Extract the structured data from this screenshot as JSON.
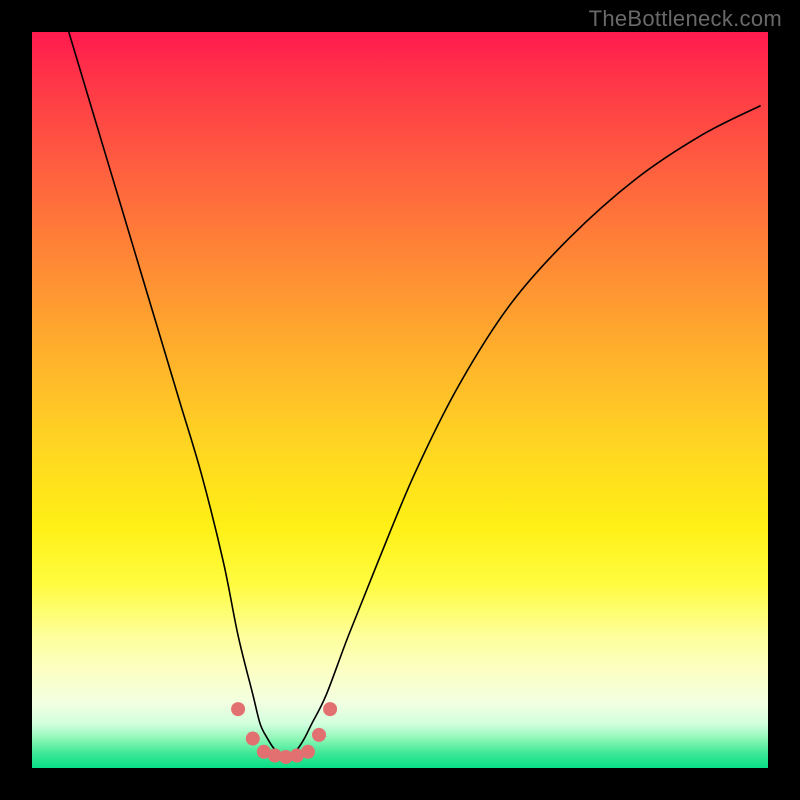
{
  "watermark": "TheBottleneck.com",
  "chart_data": {
    "type": "line",
    "title": "",
    "xlabel": "",
    "ylabel": "",
    "xlim": [
      0,
      100
    ],
    "ylim": [
      0,
      100
    ],
    "grid": false,
    "series": [
      {
        "name": "curve",
        "stroke": "#000000",
        "stroke_width": 1.6,
        "x": [
          5,
          8,
          11,
          14,
          17,
          20,
          23,
          26,
          28,
          30,
          31,
          32,
          33,
          34,
          35,
          36,
          37,
          38,
          40,
          43,
          47,
          52,
          58,
          65,
          73,
          82,
          91,
          99
        ],
        "y": [
          100,
          90,
          80,
          70,
          60,
          50,
          40,
          28,
          18,
          10,
          6,
          4,
          2.5,
          2,
          2,
          2.5,
          4,
          6,
          10,
          18,
          28,
          40,
          52,
          63,
          72,
          80,
          86,
          90
        ]
      },
      {
        "name": "markers",
        "stroke": "#e37070",
        "fill": "#e37070",
        "marker_radius": 7,
        "x": [
          28,
          30,
          31.5,
          33,
          34.5,
          36,
          37.5,
          39,
          40.5
        ],
        "y": [
          8,
          4,
          2.2,
          1.7,
          1.5,
          1.7,
          2.2,
          4.5,
          8
        ]
      }
    ],
    "background_gradient": {
      "stops": [
        {
          "pos": 0.0,
          "color": "#ff1a4e"
        },
        {
          "pos": 0.5,
          "color": "#ffd223"
        },
        {
          "pos": 0.82,
          "color": "#feff9a"
        },
        {
          "pos": 1.0,
          "color": "#07df86"
        }
      ]
    }
  }
}
